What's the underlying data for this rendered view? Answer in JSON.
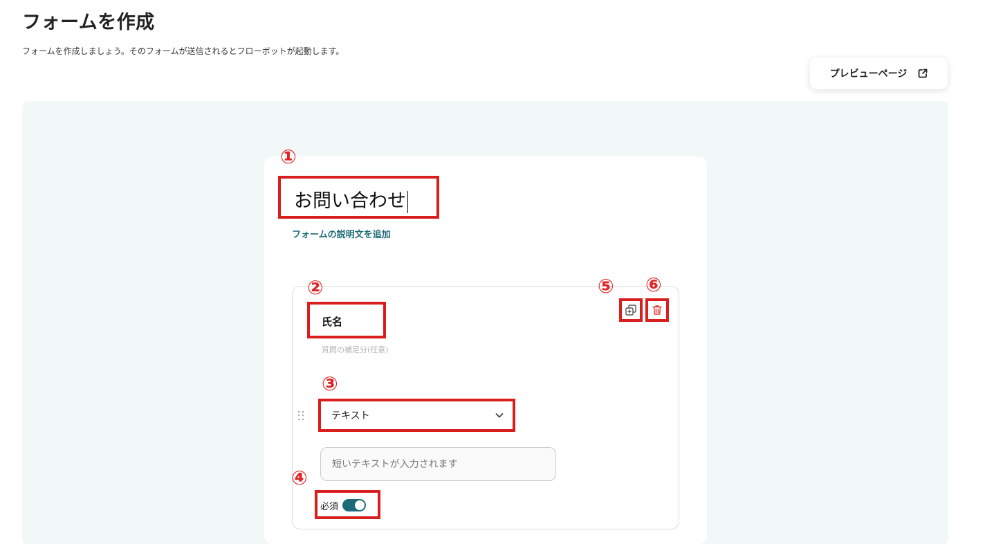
{
  "page": {
    "title": "フォームを作成",
    "description": "フォームを作成しましょう。そのフォームが送信されるとフローボットが起動します。"
  },
  "toolbar": {
    "preview_label": "プレビューページ",
    "preview_icon": "external-link-icon"
  },
  "form": {
    "title": "お問い合わせ",
    "add_description_label": "フォームの説明文を追加"
  },
  "question": {
    "label": "氏名",
    "help_placeholder": "質問の補足分(任意)",
    "type_selected": "テキスト",
    "answer_placeholder": "短いテキストが入力されます",
    "required_label": "必須",
    "required": true
  },
  "annotations": {
    "m1": "①",
    "m2": "②",
    "m3": "③",
    "m4": "④",
    "m5": "⑤",
    "m6": "⑥"
  },
  "colors": {
    "accent": "#1d6b78",
    "highlight": "#d91e1e",
    "canvas": "#f1f8f7"
  }
}
